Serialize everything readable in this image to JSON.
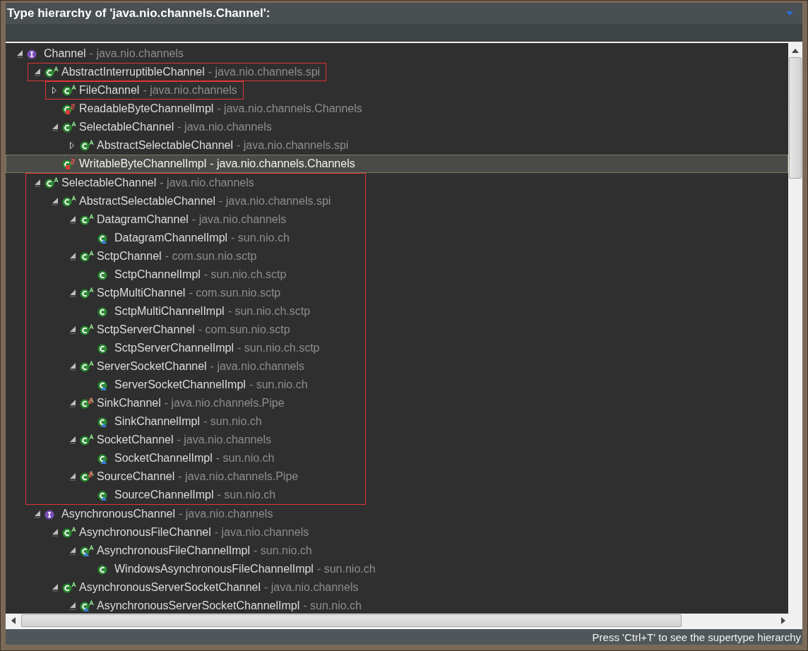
{
  "header": {
    "title": "Type hierarchy of 'java.nio.channels.Channel':"
  },
  "tree": [
    {
      "name": "Channel",
      "qualifier": "- java.nio.channels",
      "kind": "interface",
      "selected": false,
      "expanded": true,
      "children": [
        {
          "name": "AbstractInterruptibleChannel",
          "qualifier": "- java.nio.channels.spi",
          "kind": "abstract",
          "selected": false,
          "expanded": true,
          "framed": true,
          "children": [
            {
              "name": "FileChannel",
              "qualifier": "- java.nio.channels",
              "kind": "abstract",
              "selected": false,
              "expanded": false,
              "framed": true
            },
            {
              "name": "ReadableByteChannelImpl",
              "qualifier": "- java.nio.channels.Channels",
              "kind": "private_static",
              "selected": false
            },
            {
              "name": "SelectableChannel",
              "qualifier": "- java.nio.channels",
              "kind": "abstract",
              "selected": false,
              "expanded": true,
              "children": [
                {
                  "name": "AbstractSelectableChannel",
                  "qualifier": "- java.nio.channels.spi",
                  "kind": "abstract",
                  "selected": false,
                  "expanded": false
                }
              ]
            },
            {
              "name": "WritableByteChannelImpl",
              "qualifier": "- java.nio.channels.Channels",
              "kind": "private_static",
              "selected": true
            }
          ]
        },
        {
          "name": "SelectableChannel",
          "qualifier": "- java.nio.channels",
          "kind": "abstract",
          "selected": false,
          "expanded": true,
          "subtree_framed": true,
          "children": [
            {
              "name": "AbstractSelectableChannel",
              "qualifier": "- java.nio.channels.spi",
              "kind": "abstract",
              "selected": false,
              "expanded": true,
              "children": [
                {
                  "name": "DatagramChannel",
                  "qualifier": "- java.nio.channels",
                  "kind": "abstract",
                  "selected": false,
                  "expanded": true,
                  "children": [
                    {
                      "name": "DatagramChannelImpl",
                      "qualifier": "- sun.nio.ch",
                      "kind": "default",
                      "selected": false
                    }
                  ]
                },
                {
                  "name": "SctpChannel",
                  "qualifier": "- com.sun.nio.sctp",
                  "kind": "abstract",
                  "selected": false,
                  "expanded": true,
                  "children": [
                    {
                      "name": "SctpChannelImpl",
                      "qualifier": "- sun.nio.ch.sctp",
                      "kind": "class",
                      "selected": false
                    }
                  ]
                },
                {
                  "name": "SctpMultiChannel",
                  "qualifier": "- com.sun.nio.sctp",
                  "kind": "abstract",
                  "selected": false,
                  "expanded": true,
                  "children": [
                    {
                      "name": "SctpMultiChannelImpl",
                      "qualifier": "- sun.nio.ch.sctp",
                      "kind": "class",
                      "selected": false
                    }
                  ]
                },
                {
                  "name": "SctpServerChannel",
                  "qualifier": "- com.sun.nio.sctp",
                  "kind": "abstract",
                  "selected": false,
                  "expanded": true,
                  "children": [
                    {
                      "name": "SctpServerChannelImpl",
                      "qualifier": "- sun.nio.ch.sctp",
                      "kind": "class",
                      "selected": false
                    }
                  ]
                },
                {
                  "name": "ServerSocketChannel",
                  "qualifier": "- java.nio.channels",
                  "kind": "abstract",
                  "selected": false,
                  "expanded": true,
                  "children": [
                    {
                      "name": "ServerSocketChannelImpl",
                      "qualifier": "- sun.nio.ch",
                      "kind": "default",
                      "selected": false
                    }
                  ]
                },
                {
                  "name": "SinkChannel",
                  "qualifier": "- java.nio.channels.Pipe",
                  "kind": "static_abstract",
                  "selected": false,
                  "expanded": true,
                  "children": [
                    {
                      "name": "SinkChannelImpl",
                      "qualifier": "- sun.nio.ch",
                      "kind": "default",
                      "selected": false
                    }
                  ]
                },
                {
                  "name": "SocketChannel",
                  "qualifier": "- java.nio.channels",
                  "kind": "abstract",
                  "selected": false,
                  "expanded": true,
                  "children": [
                    {
                      "name": "SocketChannelImpl",
                      "qualifier": "- sun.nio.ch",
                      "kind": "default",
                      "selected": false
                    }
                  ]
                },
                {
                  "name": "SourceChannel",
                  "qualifier": "- java.nio.channels.Pipe",
                  "kind": "static_abstract",
                  "selected": false,
                  "expanded": true,
                  "children": [
                    {
                      "name": "SourceChannelImpl",
                      "qualifier": "- sun.nio.ch",
                      "kind": "default",
                      "selected": false
                    }
                  ]
                }
              ]
            }
          ]
        },
        {
          "name": "AsynchronousChannel",
          "qualifier": "- java.nio.channels",
          "kind": "interface",
          "selected": false,
          "expanded": true,
          "children": [
            {
              "name": "AsynchronousFileChannel",
              "qualifier": "- java.nio.channels",
              "kind": "abstract",
              "selected": false,
              "expanded": true,
              "children": [
                {
                  "name": "AsynchronousFileChannelImpl",
                  "qualifier": "- sun.nio.ch",
                  "kind": "default_abstract",
                  "selected": false,
                  "expanded": true,
                  "children": [
                    {
                      "name": "WindowsAsynchronousFileChannelImpl",
                      "qualifier": "- sun.nio.ch",
                      "kind": "class",
                      "selected": false
                    }
                  ]
                }
              ]
            },
            {
              "name": "AsynchronousServerSocketChannel",
              "qualifier": "- java.nio.channels",
              "kind": "abstract",
              "selected": false,
              "expanded": true,
              "children": [
                {
                  "name": "AsynchronousServerSocketChannelImpl",
                  "qualifier": "- sun.nio.ch",
                  "kind": "default_abstract",
                  "selected": false,
                  "expanded": true
                }
              ]
            }
          ]
        }
      ]
    }
  ],
  "status_bar": {
    "hint": "Press 'Ctrl+T' to see the supertype hierarchy"
  }
}
